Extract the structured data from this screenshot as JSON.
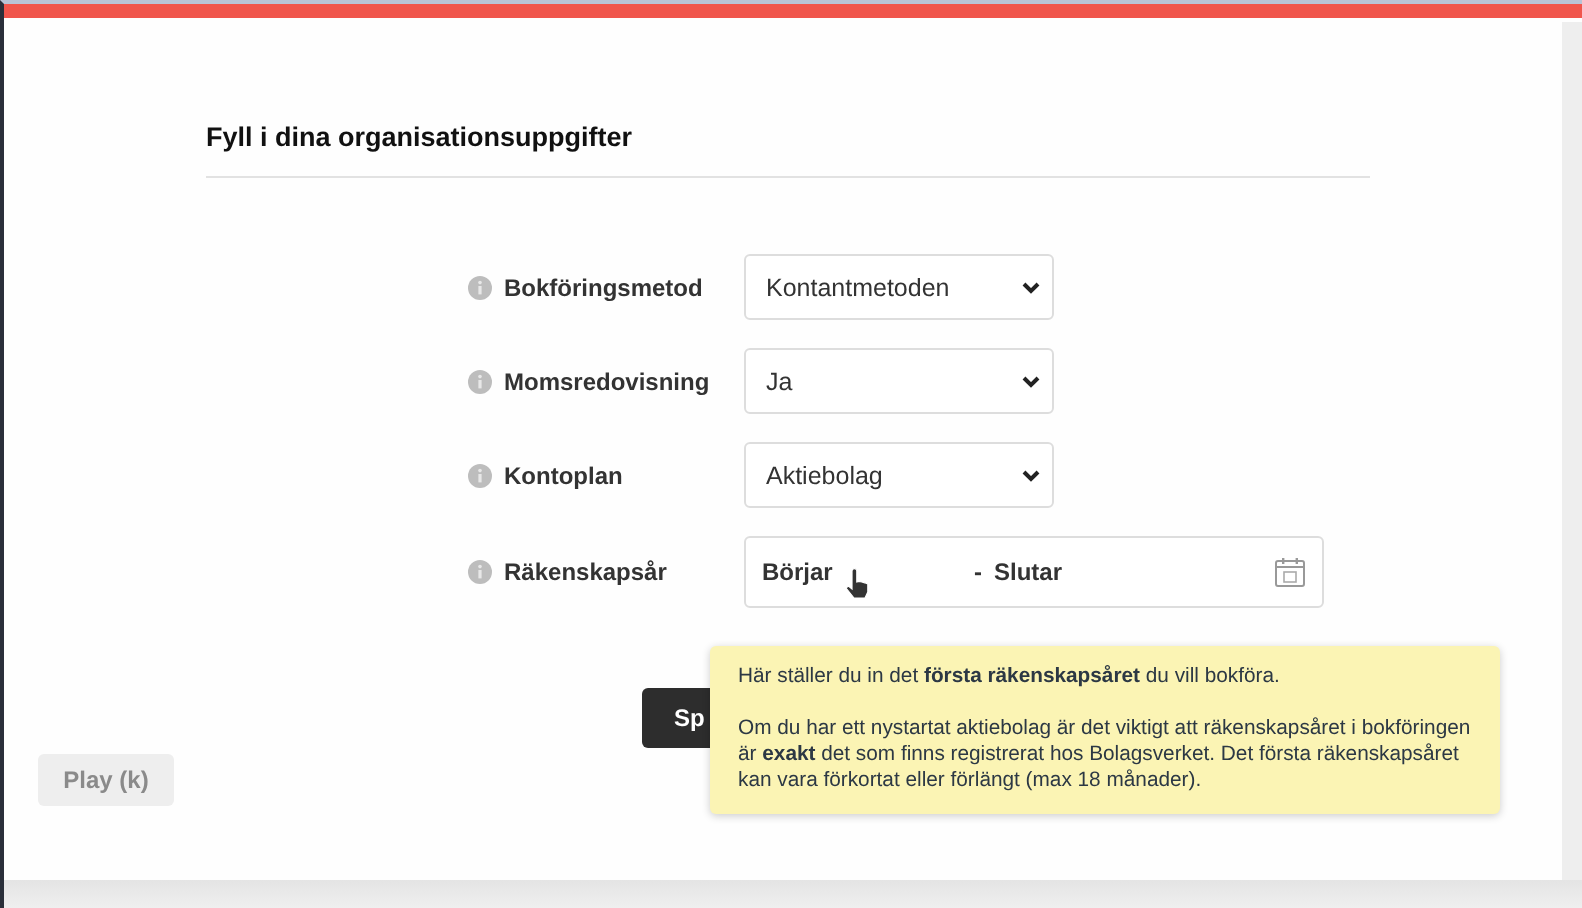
{
  "heading": "Fyll i dina organisationsuppgifter",
  "fields": [
    {
      "kind": "select",
      "label": "Bokföringsmetod",
      "value": "Kontantmetoden"
    },
    {
      "kind": "select",
      "label": "Momsredovisning",
      "value": "Ja"
    },
    {
      "kind": "select",
      "label": "Kontoplan",
      "value": "Aktiebolag"
    },
    {
      "kind": "daterange",
      "label": "Räkenskapsår",
      "start_placeholder": "Börjar",
      "separator": "-",
      "end_placeholder": "Slutar"
    }
  ],
  "button": "Sp",
  "tooltip": {
    "paragraphs": [
      "Här ställer du in det **första räkenskapsåret** du vill bokföra.",
      "Om du har ett nystartat aktiebolag är det viktigt att räkenskapsåret i bokföringen är **exakt** det som finns registrerat hos Bolagsverket. Det första räkenskapsåret kan vara förkortat eller förlängt (max 18 månader)."
    ]
  },
  "player_tooltip": "Play (k)"
}
